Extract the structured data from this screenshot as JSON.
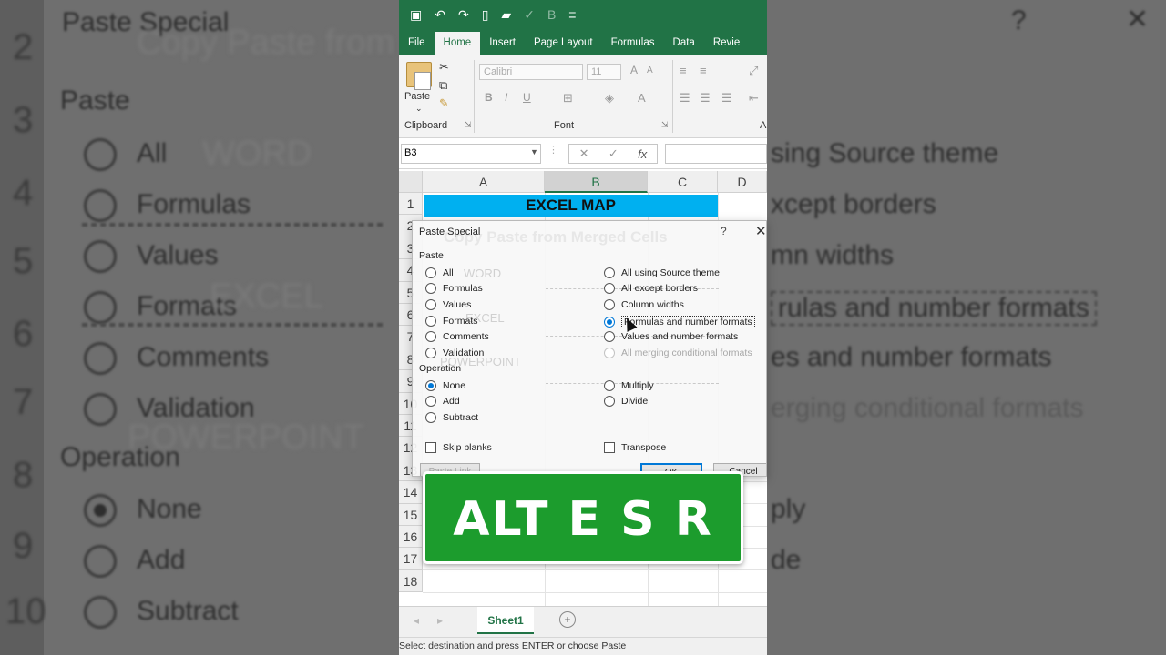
{
  "background": {
    "row_numbers": [
      "2",
      "3",
      "4",
      "5",
      "6",
      "7",
      "8",
      "9",
      "10"
    ],
    "left_title": "Paste Special",
    "help_mark": "?",
    "close_mark": "✕",
    "watermark_title": "Copy Paste from Merged Cells",
    "paste_label": "Paste",
    "left_options": [
      "All",
      "Formulas",
      "Values",
      "Formats",
      "Comments",
      "Validation"
    ],
    "operation_label": "Operation",
    "left_ops": [
      "None",
      "Add",
      "Subtract"
    ],
    "watermark_words": [
      "WORD",
      "EXCEL",
      "POWERPOINT"
    ],
    "right_options": [
      "sing Source theme",
      "xcept borders",
      "mn widths",
      "rulas and number formats",
      "es and number formats",
      "erging conditional formats"
    ],
    "right_ops": [
      "ply",
      "de"
    ]
  },
  "excel": {
    "tabs": [
      "File",
      "Home",
      "Insert",
      "Page Layout",
      "Formulas",
      "Data",
      "Revie"
    ],
    "active_tab": "Home",
    "ribbon": {
      "paste_label": "Paste",
      "clipboard_label": "Clipboard",
      "font_label": "Font",
      "font_name": "Calibri",
      "font_size": "11",
      "align_group_cut": "A"
    },
    "name_box": "B3",
    "columns": [
      "A",
      "B",
      "C",
      "D"
    ],
    "selected_column": "B",
    "rows": [
      "1",
      "2",
      "3",
      "4",
      "5",
      "6",
      "7",
      "8",
      "9",
      "10",
      "11",
      "12",
      "13",
      "14",
      "15",
      "16",
      "17",
      "18"
    ],
    "cell_a1": "EXCEL MAP",
    "sheet_tab": "Sheet1",
    "status": "Select destination and press ENTER or choose Paste"
  },
  "dialog": {
    "title": "Paste Special",
    "help": "?",
    "watermark_title": "Copy Paste from Merged Cells",
    "watermarks": [
      "WORD",
      "EXCEL",
      "POWERPOINT"
    ],
    "paste_section": "Paste",
    "paste_options_left": [
      "All",
      "Formulas",
      "Values",
      "Formats",
      "Comments",
      "Validation"
    ],
    "paste_options_right": [
      "All using Source theme",
      "All except borders",
      "Column widths",
      "Formulas and number formats",
      "Values and number formats",
      "All merging conditional formats"
    ],
    "selected_paste": "Formulas and number formats",
    "operation_section": "Operation",
    "operation_left": [
      "None",
      "Add",
      "Subtract"
    ],
    "operation_right": [
      "Multiply",
      "Divide"
    ],
    "selected_operation": "None",
    "skip_blanks": "Skip blanks",
    "transpose": "Transpose",
    "paste_link": "Paste Link",
    "ok": "OK",
    "cancel": "Cancel"
  },
  "banner": {
    "text": "ALT E S R",
    "color": "#1c9c2d"
  },
  "colors": {
    "excel_green": "#217346",
    "cell_fill": "#00b0f0",
    "radio_accent": "#0078d7"
  }
}
